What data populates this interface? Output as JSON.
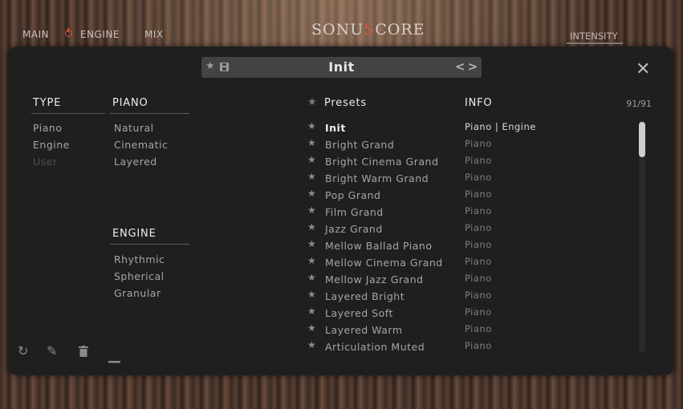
{
  "nav": {
    "main": "MAIN",
    "engine": "ENGINE",
    "mix": "MIX",
    "intensity": "INTENSITY"
  },
  "logo": {
    "left": "SONU",
    "mid": "S",
    "right": "CORE"
  },
  "preset_bar": {
    "name": "Init",
    "arrows": "<>"
  },
  "close": "✕",
  "type": {
    "header": "TYPE",
    "items": [
      "Piano",
      "Engine",
      "User"
    ]
  },
  "piano": {
    "header": "PIANO",
    "items": [
      "Natural",
      "Cinematic",
      "Layered"
    ]
  },
  "engine": {
    "header": "ENGINE",
    "items": [
      "Rhythmic",
      "Spherical",
      "Granular"
    ]
  },
  "presets": {
    "header": "Presets",
    "info_header": "INFO",
    "count": "91/91"
  },
  "rows": [
    {
      "name": "Init",
      "info": "Piano |  Engine"
    },
    {
      "name": "Bright Grand",
      "info": "Piano"
    },
    {
      "name": "Bright Cinema Grand",
      "info": "Piano"
    },
    {
      "name": "Bright Warm Grand",
      "info": "Piano"
    },
    {
      "name": "Pop Grand",
      "info": "Piano"
    },
    {
      "name": "Film Grand",
      "info": "Piano"
    },
    {
      "name": "Jazz Grand",
      "info": "Piano"
    },
    {
      "name": "Mellow Ballad Piano",
      "info": "Piano"
    },
    {
      "name": "Mellow Cinema Grand",
      "info": "Piano"
    },
    {
      "name": "Mellow Jazz Grand",
      "info": "Piano"
    },
    {
      "name": "Layered Bright",
      "info": "Piano"
    },
    {
      "name": "Layered Soft",
      "info": "Piano"
    },
    {
      "name": "Layered Warm",
      "info": "Piano"
    },
    {
      "name": "Articulation Muted",
      "info": "Piano"
    }
  ],
  "colors": {
    "accent": "#d6533f",
    "panel": "#1f1f1f",
    "active_text": "#f0f0f0"
  },
  "icons": {
    "refresh": "refresh-icon",
    "edit": "pencil-icon",
    "delete": "trash-icon",
    "remove": "minus-icon"
  }
}
